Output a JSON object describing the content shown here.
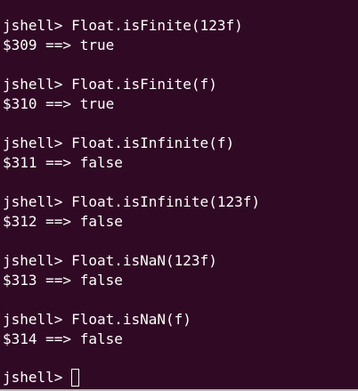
{
  "terminal": {
    "prompt": "jshell> ",
    "entries": [
      {
        "command": "jshell> Float.isFinite(123f)",
        "result": "$309 ==> true"
      },
      {
        "command": "jshell> Float.isFinite(f)",
        "result": "$310 ==> true"
      },
      {
        "command": "jshell> Float.isInfinite(f)",
        "result": "$311 ==> false"
      },
      {
        "command": "jshell> Float.isInfinite(123f)",
        "result": "$312 ==> false"
      },
      {
        "command": "jshell> Float.isNaN(123f)",
        "result": "$313 ==> false"
      },
      {
        "command": "jshell> Float.isNaN(f)",
        "result": "$314 ==> false"
      }
    ],
    "colors": {
      "background": "#300a24",
      "text": "#ffffff"
    }
  }
}
